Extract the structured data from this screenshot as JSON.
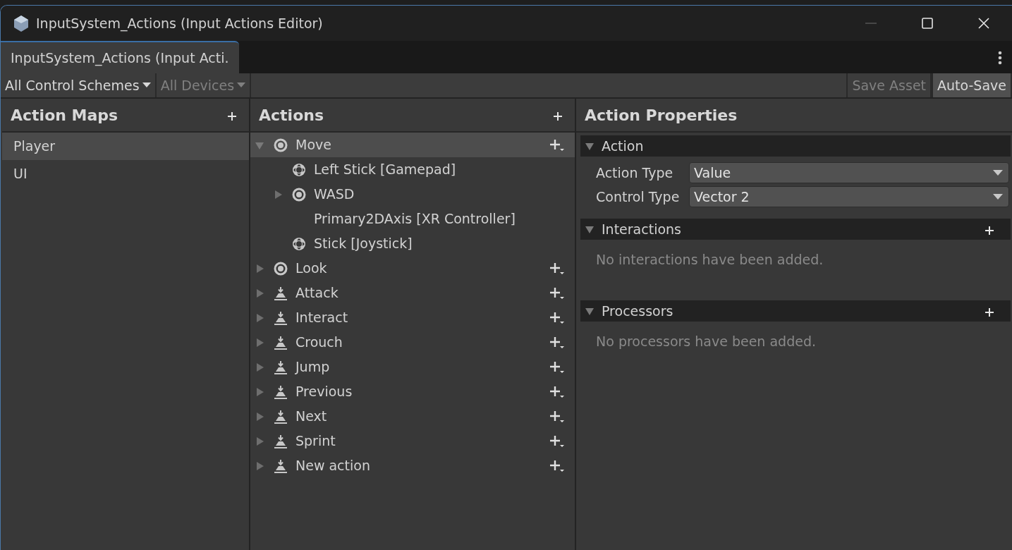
{
  "window": {
    "title": "InputSystem_Actions (Input Actions Editor)"
  },
  "tabs": [
    {
      "label": "InputSystem_Actions (Input Acti.",
      "selected": true
    }
  ],
  "toolbar": {
    "control_schemes": {
      "label": "All Control Schemes",
      "disabled": false
    },
    "devices": {
      "label": "All Devices",
      "disabled": true
    },
    "save_asset": {
      "label": "Save Asset",
      "disabled": true
    },
    "auto_save": {
      "label": "Auto-Save",
      "on": true
    }
  },
  "action_maps": {
    "title": "Action Maps",
    "items": [
      {
        "label": "Player",
        "selected": true
      },
      {
        "label": "UI",
        "selected": false
      }
    ]
  },
  "actions": {
    "title": "Actions",
    "items": [
      {
        "label": "Move",
        "kind": "value",
        "expanded": true,
        "selected": true,
        "children": [
          {
            "label": "Left Stick [Gamepad]",
            "kind": "stick"
          },
          {
            "label": "WASD",
            "kind": "composite",
            "expanded": false
          },
          {
            "label": "Primary2DAxis [XR Controller]",
            "kind": "plain"
          },
          {
            "label": "Stick [Joystick]",
            "kind": "stick"
          }
        ]
      },
      {
        "label": "Look",
        "kind": "value",
        "expanded": false,
        "selected": false
      },
      {
        "label": "Attack",
        "kind": "button",
        "expanded": false,
        "selected": false
      },
      {
        "label": "Interact",
        "kind": "button",
        "expanded": false,
        "selected": false
      },
      {
        "label": "Crouch",
        "kind": "button",
        "expanded": false,
        "selected": false
      },
      {
        "label": "Jump",
        "kind": "button",
        "expanded": false,
        "selected": false
      },
      {
        "label": "Previous",
        "kind": "button",
        "expanded": false,
        "selected": false
      },
      {
        "label": "Next",
        "kind": "button",
        "expanded": false,
        "selected": false
      },
      {
        "label": "Sprint",
        "kind": "button",
        "expanded": false,
        "selected": false
      },
      {
        "label": "New action",
        "kind": "button",
        "expanded": false,
        "selected": false
      }
    ]
  },
  "properties": {
    "title": "Action Properties",
    "sections": [
      {
        "title": "Action",
        "expanded": true,
        "kind": "fields",
        "fields": [
          {
            "label": "Action Type",
            "value": "Value"
          },
          {
            "label": "Control Type",
            "value": "Vector 2"
          }
        ]
      },
      {
        "title": "Interactions",
        "expanded": true,
        "kind": "list",
        "empty": "No interactions have been added."
      },
      {
        "title": "Processors",
        "expanded": true,
        "kind": "list",
        "empty": "No processors have been added."
      }
    ]
  }
}
